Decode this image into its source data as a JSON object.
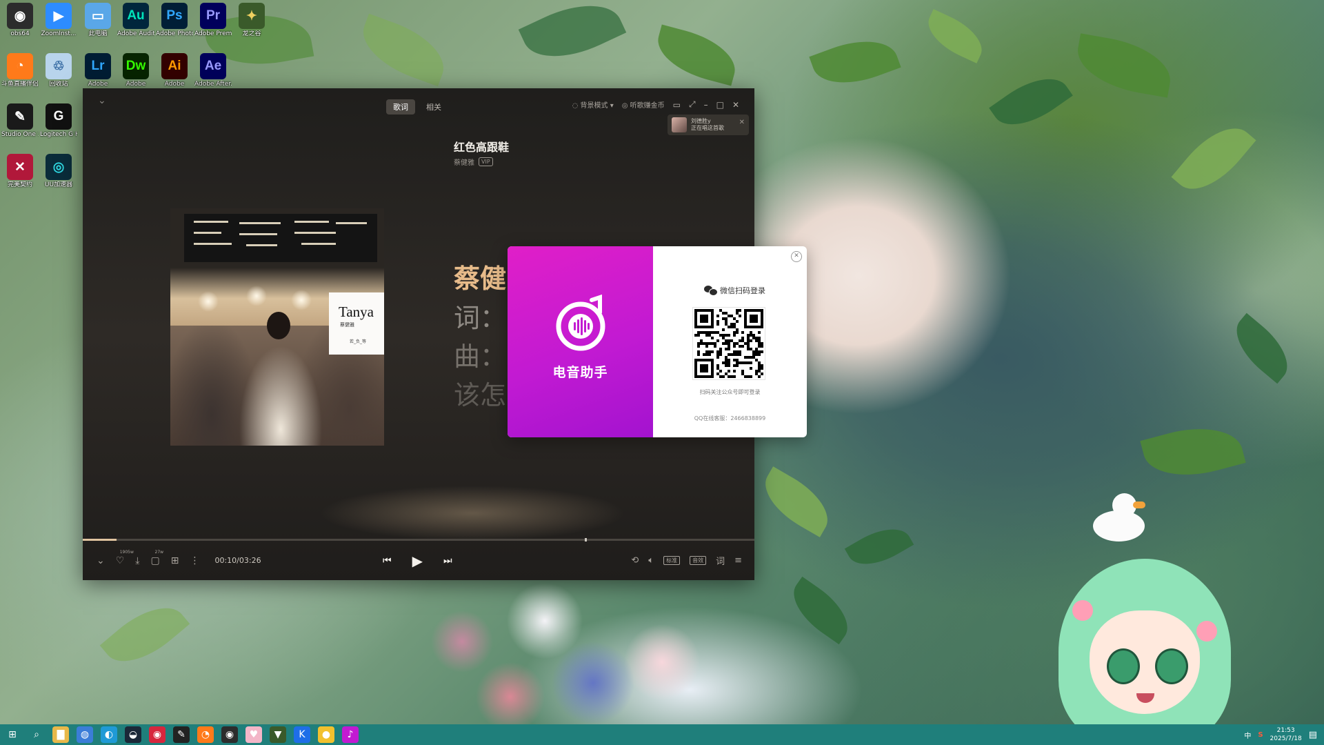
{
  "desktop": {
    "icons": [
      {
        "label": "obs64",
        "glyph": "◉",
        "bg": "#2c2c2c",
        "fg": "#ffffff"
      },
      {
        "label": "ZoomInst...",
        "glyph": "▶",
        "bg": "#2d8cff",
        "fg": "#ffffff"
      },
      {
        "label": "此电脑",
        "glyph": "▭",
        "bg": "#5aa7e8",
        "fg": "#ffffff"
      },
      {
        "label": "Adobe Auditi...",
        "glyph": "Au",
        "bg": "#00263c",
        "fg": "#00e4bb"
      },
      {
        "label": "Adobe Photosh...",
        "glyph": "Ps",
        "bg": "#001e36",
        "fg": "#31a8ff"
      },
      {
        "label": "Adobe Premie...",
        "glyph": "Pr",
        "bg": "#00005b",
        "fg": "#9999ff"
      },
      {
        "label": "龙之谷",
        "glyph": "✦",
        "bg": "#3a5a2a",
        "fg": "#f0d060"
      },
      {
        "label": "斗鱼直播伴侣",
        "glyph": "◔",
        "bg": "#ff7a1a",
        "fg": "#ffffff"
      },
      {
        "label": "回收站",
        "glyph": "♲",
        "bg": "#b8d4ec",
        "fg": "#3a6ea5"
      },
      {
        "label": "Adobe",
        "glyph": "Lr",
        "bg": "#001d34",
        "fg": "#31a8ff"
      },
      {
        "label": "Adobe",
        "glyph": "Dw",
        "bg": "#072401",
        "fg": "#35fa00"
      },
      {
        "label": "Adobe",
        "glyph": "Ai",
        "bg": "#330000",
        "fg": "#ff9a00"
      },
      {
        "label": "Adobe After...",
        "glyph": "Ae",
        "bg": "#00005b",
        "fg": "#9999ff"
      },
      {
        "label": "Studio One 3",
        "glyph": "✎",
        "bg": "#1a1a1a",
        "fg": "#ffffff"
      },
      {
        "label": "Logitech G HUB",
        "glyph": "G",
        "bg": "#111111",
        "fg": "#ffffff"
      },
      {
        "label": "完美契约",
        "glyph": "✕",
        "bg": "#b1183a",
        "fg": "#ffffff"
      },
      {
        "label": "UU加速器",
        "glyph": "◎",
        "bg": "#0a2c3a",
        "fg": "#2fd6e0"
      }
    ]
  },
  "player": {
    "tabs": [
      {
        "label": "歌词",
        "active": true
      },
      {
        "label": "相关",
        "active": false
      }
    ],
    "background_mode": "背景模式",
    "earn_coins": "听歌赚金币",
    "notification": {
      "line1": "刘德胜y",
      "line2": "正在唱这首歌"
    },
    "song": {
      "title": "红色高跟鞋",
      "artist": "蔡健雅",
      "badge": "VIP"
    },
    "cover": {
      "card_title": "Tanya",
      "card_sub": "蔡健雅",
      "card_line": "若_负_等"
    },
    "lyrics": {
      "current": "蔡健",
      "line2": "词：",
      "line3": "曲：",
      "line4": "该怎么去形容你最贴"
    },
    "controls": {
      "like_count": "1905w",
      "comment_count": "27w",
      "time": "00:10/03:26",
      "progress_fraction": 0.05,
      "quality": "标准",
      "sound_effect": "音效",
      "lyric_btn": "词"
    }
  },
  "login_dialog": {
    "brand_name": "电音助手",
    "brand_color": "#d11ccf",
    "qr_title": "微信扫码登录",
    "qr_hint": "扫码关注公众号即可登录",
    "qq_support": "QQ在线客服：2466838899"
  },
  "taskbar": {
    "clock_time": "21:53",
    "clock_date": "2025/7/18",
    "ime": "中",
    "apps": [
      {
        "name": "start",
        "glyph": "⊞",
        "bg": "transparent"
      },
      {
        "name": "search",
        "glyph": "⌕",
        "bg": "transparent"
      },
      {
        "name": "file-explorer",
        "glyph": "▇",
        "bg": "#e8b84a"
      },
      {
        "name": "browser",
        "glyph": "◍",
        "bg": "#3b7dd8"
      },
      {
        "name": "edge",
        "glyph": "◐",
        "bg": "#1f9ad6"
      },
      {
        "name": "steam",
        "glyph": "◒",
        "bg": "#1b2838"
      },
      {
        "name": "netease-music",
        "glyph": "◉",
        "bg": "#d7263d"
      },
      {
        "name": "studio-one",
        "glyph": "✎",
        "bg": "#222222"
      },
      {
        "name": "douyu",
        "glyph": "◔",
        "bg": "#ff7a1a"
      },
      {
        "name": "obs",
        "glyph": "◉",
        "bg": "#2c2c2c"
      },
      {
        "name": "photo-app",
        "glyph": "♥",
        "bg": "#f3b6c8"
      },
      {
        "name": "game",
        "glyph": "▼",
        "bg": "#3a5a2a"
      },
      {
        "name": "kugou",
        "glyph": "K",
        "bg": "#1e6ee8"
      },
      {
        "name": "yellow-app",
        "glyph": "●",
        "bg": "#f2c12e"
      },
      {
        "name": "dianyin-assistant",
        "glyph": "♪",
        "bg": "#c21ad2"
      }
    ]
  }
}
